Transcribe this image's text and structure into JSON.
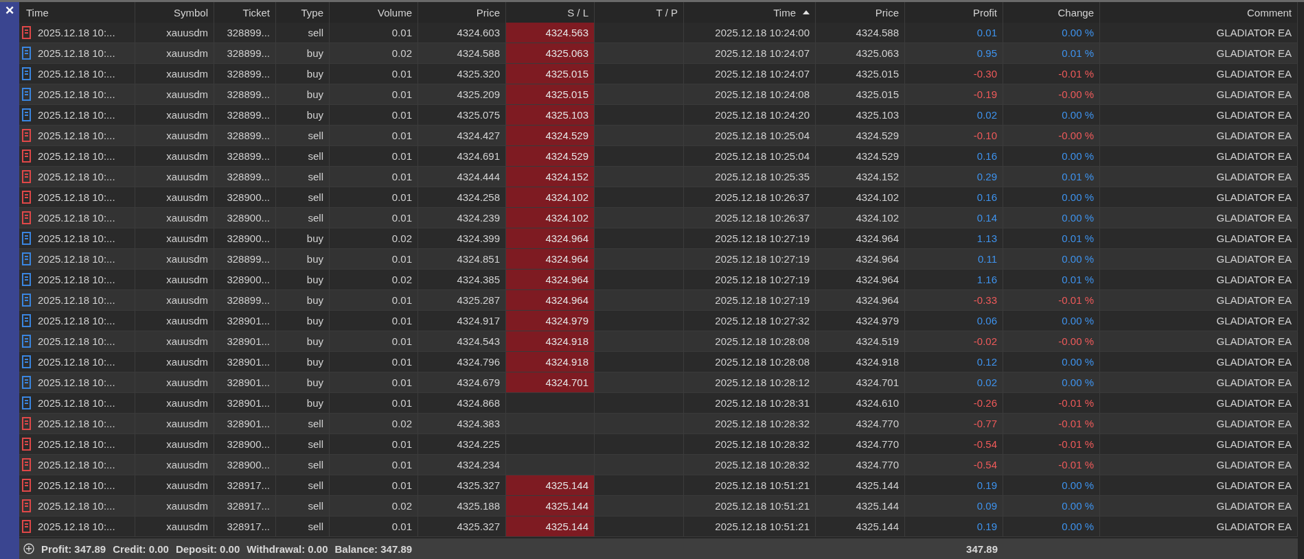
{
  "close_button": "✕",
  "columns": [
    {
      "label": "Time",
      "sorted": false
    },
    {
      "label": "Symbol",
      "sorted": false
    },
    {
      "label": "Ticket",
      "sorted": false
    },
    {
      "label": "Type",
      "sorted": false
    },
    {
      "label": "Volume",
      "sorted": false
    },
    {
      "label": "Price",
      "sorted": false
    },
    {
      "label": "S / L",
      "sorted": false
    },
    {
      "label": "T / P",
      "sorted": false
    },
    {
      "label": "Time",
      "sorted": true
    },
    {
      "label": "Price",
      "sorted": false
    },
    {
      "label": "Profit",
      "sorted": false
    },
    {
      "label": "Change",
      "sorted": false
    },
    {
      "label": "Comment",
      "sorted": false
    }
  ],
  "rows": [
    {
      "color": "#e04848",
      "time": "2025.12.18 10:...",
      "symbol": "xauusdm",
      "ticket": "328899...",
      "type": "sell",
      "volume": "0.01",
      "price": "4324.603",
      "sl": "4324.563",
      "close_time": "2025.12.18 10:24:00",
      "close_price": "4324.588",
      "profit": "0.01",
      "change": "0.00 %",
      "loss": false,
      "comment": "GLADIATOR EA"
    },
    {
      "color": "#3a86e0",
      "time": "2025.12.18 10:...",
      "symbol": "xauusdm",
      "ticket": "328899...",
      "type": "buy",
      "volume": "0.02",
      "price": "4324.588",
      "sl": "4325.063",
      "close_time": "2025.12.18 10:24:07",
      "close_price": "4325.063",
      "profit": "0.95",
      "change": "0.01 %",
      "loss": false,
      "comment": "GLADIATOR EA"
    },
    {
      "color": "#3a86e0",
      "time": "2025.12.18 10:...",
      "symbol": "xauusdm",
      "ticket": "328899...",
      "type": "buy",
      "volume": "0.01",
      "price": "4325.320",
      "sl": "4325.015",
      "close_time": "2025.12.18 10:24:07",
      "close_price": "4325.015",
      "profit": "-0.30",
      "change": "-0.01 %",
      "loss": true,
      "comment": "GLADIATOR EA"
    },
    {
      "color": "#3a86e0",
      "time": "2025.12.18 10:...",
      "symbol": "xauusdm",
      "ticket": "328899...",
      "type": "buy",
      "volume": "0.01",
      "price": "4325.209",
      "sl": "4325.015",
      "close_time": "2025.12.18 10:24:08",
      "close_price": "4325.015",
      "profit": "-0.19",
      "change": "-0.00 %",
      "loss": true,
      "comment": "GLADIATOR EA"
    },
    {
      "color": "#3a86e0",
      "time": "2025.12.18 10:...",
      "symbol": "xauusdm",
      "ticket": "328899...",
      "type": "buy",
      "volume": "0.01",
      "price": "4325.075",
      "sl": "4325.103",
      "close_time": "2025.12.18 10:24:20",
      "close_price": "4325.103",
      "profit": "0.02",
      "change": "0.00 %",
      "loss": false,
      "comment": "GLADIATOR EA"
    },
    {
      "color": "#e04848",
      "time": "2025.12.18 10:...",
      "symbol": "xauusdm",
      "ticket": "328899...",
      "type": "sell",
      "volume": "0.01",
      "price": "4324.427",
      "sl": "4324.529",
      "close_time": "2025.12.18 10:25:04",
      "close_price": "4324.529",
      "profit": "-0.10",
      "change": "-0.00 %",
      "loss": true,
      "comment": "GLADIATOR EA"
    },
    {
      "color": "#e04848",
      "time": "2025.12.18 10:...",
      "symbol": "xauusdm",
      "ticket": "328899...",
      "type": "sell",
      "volume": "0.01",
      "price": "4324.691",
      "sl": "4324.529",
      "close_time": "2025.12.18 10:25:04",
      "close_price": "4324.529",
      "profit": "0.16",
      "change": "0.00 %",
      "loss": false,
      "comment": "GLADIATOR EA"
    },
    {
      "color": "#e04848",
      "time": "2025.12.18 10:...",
      "symbol": "xauusdm",
      "ticket": "328899...",
      "type": "sell",
      "volume": "0.01",
      "price": "4324.444",
      "sl": "4324.152",
      "close_time": "2025.12.18 10:25:35",
      "close_price": "4324.152",
      "profit": "0.29",
      "change": "0.01 %",
      "loss": false,
      "comment": "GLADIATOR EA"
    },
    {
      "color": "#e04848",
      "time": "2025.12.18 10:...",
      "symbol": "xauusdm",
      "ticket": "328900...",
      "type": "sell",
      "volume": "0.01",
      "price": "4324.258",
      "sl": "4324.102",
      "close_time": "2025.12.18 10:26:37",
      "close_price": "4324.102",
      "profit": "0.16",
      "change": "0.00 %",
      "loss": false,
      "comment": "GLADIATOR EA"
    },
    {
      "color": "#e04848",
      "time": "2025.12.18 10:...",
      "symbol": "xauusdm",
      "ticket": "328900...",
      "type": "sell",
      "volume": "0.01",
      "price": "4324.239",
      "sl": "4324.102",
      "close_time": "2025.12.18 10:26:37",
      "close_price": "4324.102",
      "profit": "0.14",
      "change": "0.00 %",
      "loss": false,
      "comment": "GLADIATOR EA"
    },
    {
      "color": "#3a86e0",
      "time": "2025.12.18 10:...",
      "symbol": "xauusdm",
      "ticket": "328900...",
      "type": "buy",
      "volume": "0.02",
      "price": "4324.399",
      "sl": "4324.964",
      "close_time": "2025.12.18 10:27:19",
      "close_price": "4324.964",
      "profit": "1.13",
      "change": "0.01 %",
      "loss": false,
      "comment": "GLADIATOR EA"
    },
    {
      "color": "#3a86e0",
      "time": "2025.12.18 10:...",
      "symbol": "xauusdm",
      "ticket": "328899...",
      "type": "buy",
      "volume": "0.01",
      "price": "4324.851",
      "sl": "4324.964",
      "close_time": "2025.12.18 10:27:19",
      "close_price": "4324.964",
      "profit": "0.11",
      "change": "0.00 %",
      "loss": false,
      "comment": "GLADIATOR EA"
    },
    {
      "color": "#3a86e0",
      "time": "2025.12.18 10:...",
      "symbol": "xauusdm",
      "ticket": "328900...",
      "type": "buy",
      "volume": "0.02",
      "price": "4324.385",
      "sl": "4324.964",
      "close_time": "2025.12.18 10:27:19",
      "close_price": "4324.964",
      "profit": "1.16",
      "change": "0.01 %",
      "loss": false,
      "comment": "GLADIATOR EA"
    },
    {
      "color": "#3a86e0",
      "time": "2025.12.18 10:...",
      "symbol": "xauusdm",
      "ticket": "328899...",
      "type": "buy",
      "volume": "0.01",
      "price": "4325.287",
      "sl": "4324.964",
      "close_time": "2025.12.18 10:27:19",
      "close_price": "4324.964",
      "profit": "-0.33",
      "change": "-0.01 %",
      "loss": true,
      "comment": "GLADIATOR EA"
    },
    {
      "color": "#3a86e0",
      "time": "2025.12.18 10:...",
      "symbol": "xauusdm",
      "ticket": "328901...",
      "type": "buy",
      "volume": "0.01",
      "price": "4324.917",
      "sl": "4324.979",
      "close_time": "2025.12.18 10:27:32",
      "close_price": "4324.979",
      "profit": "0.06",
      "change": "0.00 %",
      "loss": false,
      "comment": "GLADIATOR EA"
    },
    {
      "color": "#3a86e0",
      "time": "2025.12.18 10:...",
      "symbol": "xauusdm",
      "ticket": "328901...",
      "type": "buy",
      "volume": "0.01",
      "price": "4324.543",
      "sl": "4324.918",
      "close_time": "2025.12.18 10:28:08",
      "close_price": "4324.519",
      "profit": "-0.02",
      "change": "-0.00 %",
      "loss": true,
      "comment": "GLADIATOR EA"
    },
    {
      "color": "#3a86e0",
      "time": "2025.12.18 10:...",
      "symbol": "xauusdm",
      "ticket": "328901...",
      "type": "buy",
      "volume": "0.01",
      "price": "4324.796",
      "sl": "4324.918",
      "close_time": "2025.12.18 10:28:08",
      "close_price": "4324.918",
      "profit": "0.12",
      "change": "0.00 %",
      "loss": false,
      "comment": "GLADIATOR EA"
    },
    {
      "color": "#3a86e0",
      "time": "2025.12.18 10:...",
      "symbol": "xauusdm",
      "ticket": "328901...",
      "type": "buy",
      "volume": "0.01",
      "price": "4324.679",
      "sl": "4324.701",
      "close_time": "2025.12.18 10:28:12",
      "close_price": "4324.701",
      "profit": "0.02",
      "change": "0.00 %",
      "loss": false,
      "comment": "GLADIATOR EA"
    },
    {
      "color": "#3a86e0",
      "time": "2025.12.18 10:...",
      "symbol": "xauusdm",
      "ticket": "328901...",
      "type": "buy",
      "volume": "0.01",
      "price": "4324.868",
      "close_time": "2025.12.18 10:28:31",
      "close_price": "4324.610",
      "profit": "-0.26",
      "change": "-0.01 %",
      "loss": true,
      "comment": "GLADIATOR EA"
    },
    {
      "color": "#e04848",
      "time": "2025.12.18 10:...",
      "symbol": "xauusdm",
      "ticket": "328901...",
      "type": "sell",
      "volume": "0.02",
      "price": "4324.383",
      "close_time": "2025.12.18 10:28:32",
      "close_price": "4324.770",
      "profit": "-0.77",
      "change": "-0.01 %",
      "loss": true,
      "comment": "GLADIATOR EA"
    },
    {
      "color": "#e04848",
      "time": "2025.12.18 10:...",
      "symbol": "xauusdm",
      "ticket": "328900...",
      "type": "sell",
      "volume": "0.01",
      "price": "4324.225",
      "close_time": "2025.12.18 10:28:32",
      "close_price": "4324.770",
      "profit": "-0.54",
      "change": "-0.01 %",
      "loss": true,
      "comment": "GLADIATOR EA"
    },
    {
      "color": "#e04848",
      "time": "2025.12.18 10:...",
      "symbol": "xauusdm",
      "ticket": "328900...",
      "type": "sell",
      "volume": "0.01",
      "price": "4324.234",
      "close_time": "2025.12.18 10:28:32",
      "close_price": "4324.770",
      "profit": "-0.54",
      "change": "-0.01 %",
      "loss": true,
      "comment": "GLADIATOR EA"
    },
    {
      "color": "#e04848",
      "time": "2025.12.18 10:...",
      "symbol": "xauusdm",
      "ticket": "328917...",
      "type": "sell",
      "volume": "0.01",
      "price": "4325.327",
      "sl": "4325.144",
      "close_time": "2025.12.18 10:51:21",
      "close_price": "4325.144",
      "profit": "0.19",
      "change": "0.00 %",
      "loss": false,
      "comment": "GLADIATOR EA"
    },
    {
      "color": "#e04848",
      "time": "2025.12.18 10:...",
      "symbol": "xauusdm",
      "ticket": "328917...",
      "type": "sell",
      "volume": "0.02",
      "price": "4325.188",
      "sl": "4325.144",
      "close_time": "2025.12.18 10:51:21",
      "close_price": "4325.144",
      "profit": "0.09",
      "change": "0.00 %",
      "loss": false,
      "comment": "GLADIATOR EA"
    },
    {
      "color": "#e04848",
      "time": "2025.12.18 10:...",
      "symbol": "xauusdm",
      "ticket": "328917...",
      "type": "sell",
      "volume": "0.01",
      "price": "4325.327",
      "sl": "4325.144",
      "close_time": "2025.12.18 10:51:21",
      "close_price": "4325.144",
      "profit": "0.19",
      "change": "0.00 %",
      "loss": false,
      "comment": "GLADIATOR EA"
    }
  ],
  "summary": [
    "Profit: 347.89",
    "Credit: 0.00",
    "Deposit: 0.00",
    "Withdrawal: 0.00",
    "Balance: 347.89"
  ],
  "total_profit": "347.89"
}
